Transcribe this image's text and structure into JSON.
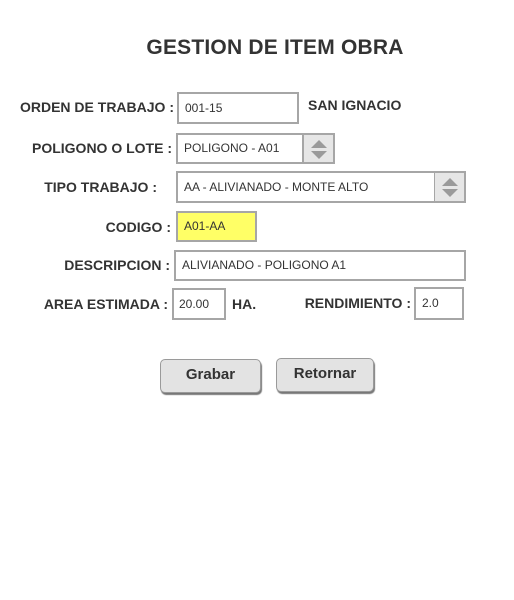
{
  "title": "GESTION DE ITEM OBRA",
  "form": {
    "orden": {
      "label": "ORDEN DE TRABAJO :",
      "value": "001-15",
      "extra": "SAN IGNACIO"
    },
    "poligono": {
      "label": "POLIGONO O LOTE :",
      "value": "POLIGONO - A01"
    },
    "tipo": {
      "label": "TIPO TRABAJO :",
      "value": "AA - ALIVIANADO - MONTE ALTO"
    },
    "codigo": {
      "label": "CODIGO :",
      "value": "A01-AA",
      "highlight": "#ffff66"
    },
    "descripcion": {
      "label": "DESCRIPCION :",
      "value": "ALIVIANADO - POLIGONO A1"
    },
    "area": {
      "label": "AREA ESTIMADA :",
      "value": "20.00",
      "unit": "HA."
    },
    "rendimiento": {
      "label": "RENDIMIENTO :",
      "value": "2.0"
    }
  },
  "buttons": {
    "save": "Grabar",
    "back": "Retornar"
  },
  "icons": {
    "spinner": "up-down-arrows-icon"
  }
}
